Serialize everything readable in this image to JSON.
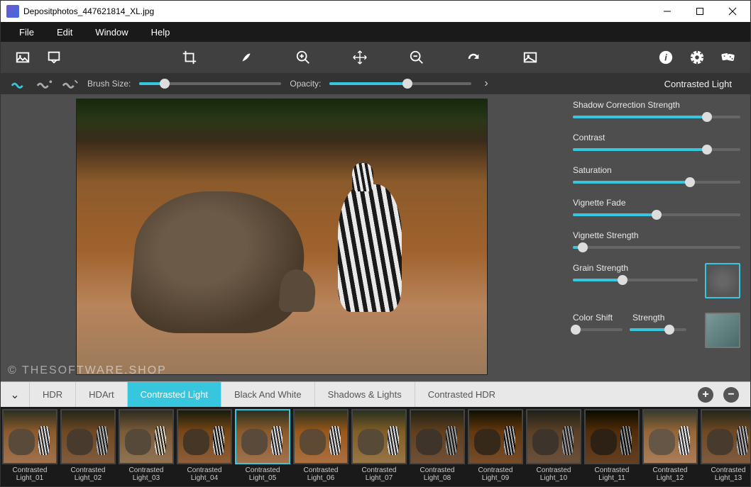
{
  "window": {
    "title": "Depositphotos_447621814_XL.jpg"
  },
  "menu": {
    "file": "File",
    "edit": "Edit",
    "window": "Window",
    "help": "Help"
  },
  "brushbar": {
    "brush_label": "Brush Size:",
    "opacity_label": "Opacity:",
    "brush_value": 18,
    "opacity_value": 55,
    "panel_title": "Contrasted Light"
  },
  "params": {
    "shadow_label": "Shadow Correction Strength",
    "shadow_value": 80,
    "contrast_label": "Contrast",
    "contrast_value": 80,
    "saturation_label": "Saturation",
    "saturation_value": 70,
    "vignette_fade_label": "Vignette Fade",
    "vignette_fade_value": 50,
    "vignette_strength_label": "Vignette Strength",
    "vignette_strength_value": 6,
    "grain_label": "Grain Strength",
    "grain_value": 40,
    "colorshift_label": "Color Shift",
    "strength_label": "Strength",
    "colorshift_value": 6,
    "strength_value": 70
  },
  "tabs": {
    "hdr": "HDR",
    "hdart": "HDArt",
    "contrasted": "Contrasted Light",
    "bw": "Black And White",
    "shadows": "Shadows & Lights",
    "chdr": "Contrasted HDR"
  },
  "thumbs": [
    {
      "l1": "Contrasted",
      "l2": "Light_01"
    },
    {
      "l1": "Contrasted",
      "l2": "Light_02"
    },
    {
      "l1": "Contrasted",
      "l2": "Light_03"
    },
    {
      "l1": "Contrasted",
      "l2": "Light_04"
    },
    {
      "l1": "Contrasted",
      "l2": "Light_05"
    },
    {
      "l1": "Contrasted",
      "l2": "Light_06"
    },
    {
      "l1": "Contrasted",
      "l2": "Light_07"
    },
    {
      "l1": "Contrasted",
      "l2": "Light_08"
    },
    {
      "l1": "Contrasted",
      "l2": "Light_09"
    },
    {
      "l1": "Contrasted",
      "l2": "Light_10"
    },
    {
      "l1": "Contrasted",
      "l2": "Light_11"
    },
    {
      "l1": "Contrasted",
      "l2": "Light_12"
    },
    {
      "l1": "Contrasted",
      "l2": "Light_13"
    }
  ],
  "watermark": "© THESOFTWARE.SHOP"
}
